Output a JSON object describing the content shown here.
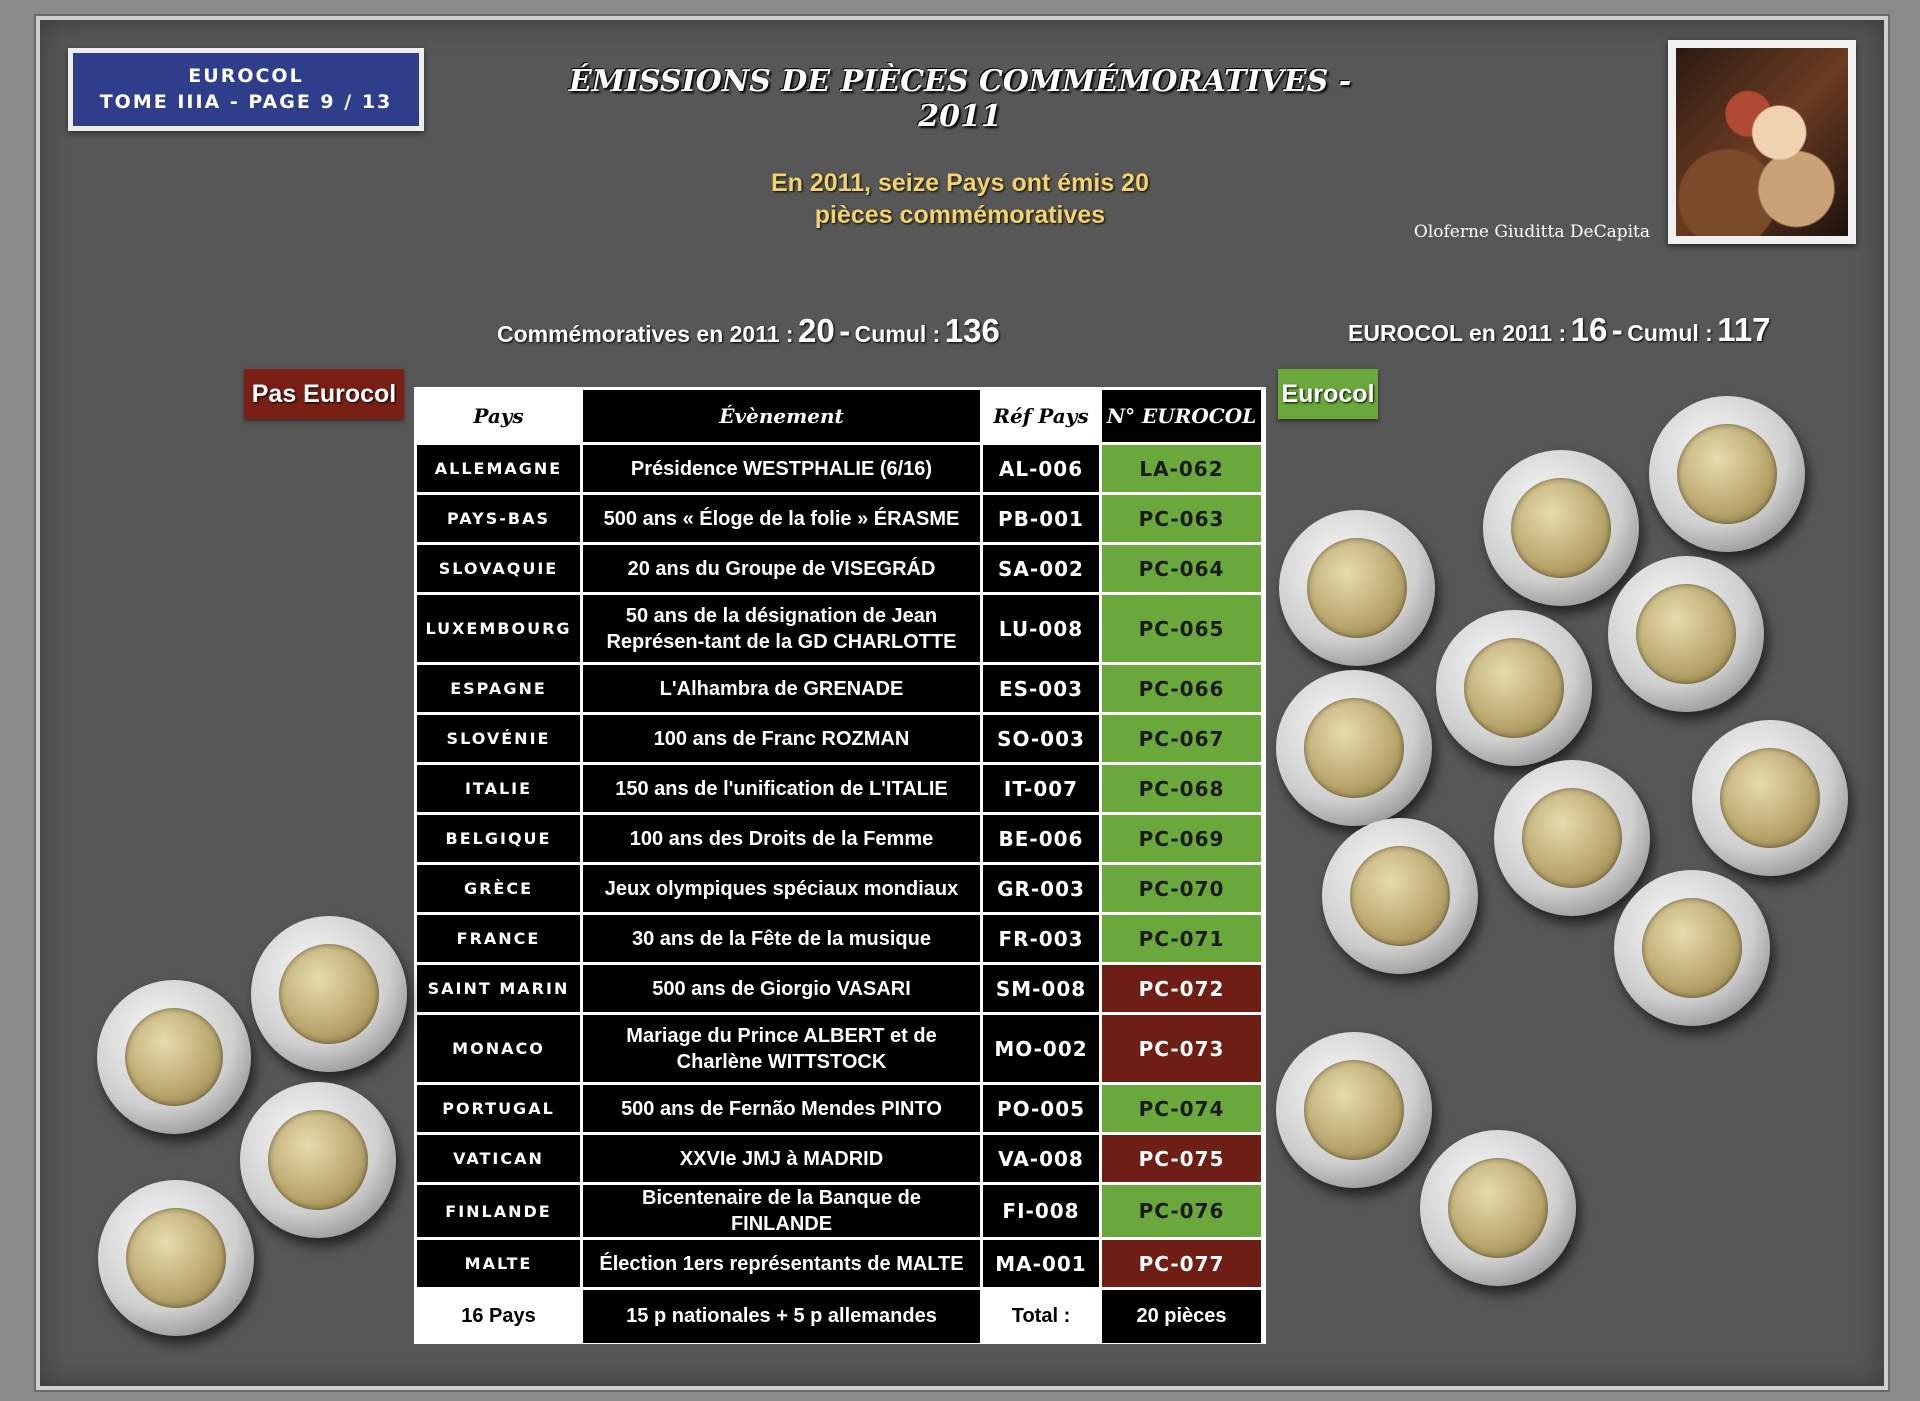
{
  "header": {
    "tome_line1": "EUROCOL",
    "tome_line2": "TOME IIIA - PAGE 9 / 13",
    "title": "ÉMISSIONS DE PIÈCES COMMÉMORATIVES - 2011",
    "subtitle_line1": "En 2011, seize Pays ont émis 20",
    "subtitle_line2": "pièces commémoratives",
    "portrait_caption": "Oloferne Giuditta DeCapita"
  },
  "stats": {
    "left_label": "Commémoratives en 2011 :",
    "left_value": "20",
    "left_sep": "-",
    "left_cumul_label": "Cumul :",
    "left_cumul_value": "136",
    "right_label": "EUROCOL en 2011 :",
    "right_value": "16",
    "right_sep": "-",
    "right_cumul_label": "Cumul :",
    "right_cumul_value": "117"
  },
  "tags": {
    "not_eurocol": "Pas Eurocol",
    "eurocol": "Eurocol"
  },
  "table": {
    "headers": [
      "Pays",
      "Évènement",
      "Réf Pays",
      "N° EUROCOL"
    ],
    "rows": [
      {
        "country": "ALLEMAGNE",
        "event": "Présidence WESTPHALIE (6/16)",
        "ref": "AL-006",
        "code": "LA-062",
        "eurocol": "green"
      },
      {
        "country": "PAYS-BAS",
        "event": "500 ans « Éloge de la folie » ÉRASME",
        "ref": "PB-001",
        "code": "PC-063",
        "eurocol": "green"
      },
      {
        "country": "SLOVAQUIE",
        "event": "20 ans du Groupe de VISEGRÁD",
        "ref": "SA-002",
        "code": "PC-064",
        "eurocol": "green"
      },
      {
        "country": "LUXEMBOURG",
        "event": "50 ans de la désignation de Jean Représen-tant de la GD CHARLOTTE",
        "ref": "LU-008",
        "code": "PC-065",
        "eurocol": "green"
      },
      {
        "country": "ESPAGNE",
        "event": "L'Alhambra de GRENADE",
        "ref": "ES-003",
        "code": "PC-066",
        "eurocol": "green"
      },
      {
        "country": "SLOVÉNIE",
        "event": "100 ans de Franc ROZMAN",
        "ref": "SO-003",
        "code": "PC-067",
        "eurocol": "green"
      },
      {
        "country": "ITALIE",
        "event": "150 ans de l'unification de L'ITALIE",
        "ref": "IT-007",
        "code": "PC-068",
        "eurocol": "green"
      },
      {
        "country": "BELGIQUE",
        "event": "100 ans des Droits de la Femme",
        "ref": "BE-006",
        "code": "PC-069",
        "eurocol": "green"
      },
      {
        "country": "GRÈCE",
        "event": "Jeux olympiques spéciaux mondiaux",
        "ref": "GR-003",
        "code": "PC-070",
        "eurocol": "green"
      },
      {
        "country": "FRANCE",
        "event": "30 ans de la Fête de la musique",
        "ref": "FR-003",
        "code": "PC-071",
        "eurocol": "green"
      },
      {
        "country": "SAINT MARIN",
        "event": "500 ans de Giorgio VASARI",
        "ref": "SM-008",
        "code": "PC-072",
        "eurocol": "red"
      },
      {
        "country": "MONACO",
        "event": "Mariage du Prince ALBERT et de Charlène WITTSTOCK",
        "ref": "MO-002",
        "code": "PC-073",
        "eurocol": "red"
      },
      {
        "country": "PORTUGAL",
        "event": "500 ans de Fernão Mendes PINTO",
        "ref": "PO-005",
        "code": "PC-074",
        "eurocol": "green"
      },
      {
        "country": "VATICAN",
        "event": "XXVIe JMJ à MADRID",
        "ref": "VA-008",
        "code": "PC-075",
        "eurocol": "red"
      },
      {
        "country": "FINLANDE",
        "event": "Bicentenaire de la Banque de FINLANDE",
        "ref": "FI-008",
        "code": "PC-076",
        "eurocol": "green"
      },
      {
        "country": "MALTE",
        "event": "Élection 1ers représentants de MALTE",
        "ref": "MA-001",
        "code": "PC-077",
        "eurocol": "red"
      }
    ],
    "footer": [
      "16 Pays",
      "15 p nationales + 5 p allemandes",
      "Total :",
      "20 pièces"
    ]
  },
  "colors": {
    "green": "#6aa83c",
    "red": "#6e1e14",
    "title_gold": "#f4d46a",
    "tome_blue": "#2e3e8a"
  }
}
